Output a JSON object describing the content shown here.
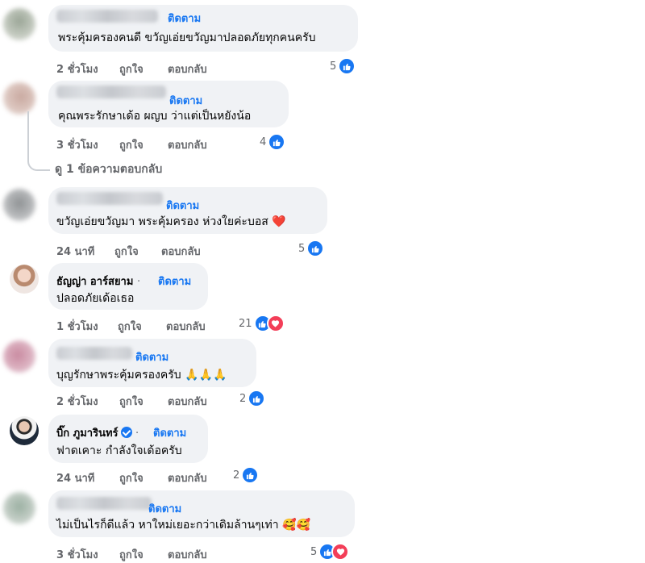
{
  "follow_label": "ติดตาม",
  "action_like": "ถูกใจ",
  "action_reply": "ตอบกลับ",
  "dot_separator": "·",
  "view_replies": "ดู 1 ข้อความตอบกลับ",
  "comments": [
    {
      "name": "",
      "text": "พระคุ้มครองคนดี ขวัญเอ่ยขวัญมาปลอดภัยทุกคนครับ",
      "time": "2 ชั่วโมง",
      "reaction_count": "5",
      "reactions": [
        "like"
      ],
      "emoji": ""
    },
    {
      "name": "",
      "text": "คุณพระรักษาเด้อ ผญบ ว่าแต่เป็นหยังน้อ",
      "time": "3 ชั่วโมง",
      "reaction_count": "4",
      "reactions": [
        "like"
      ],
      "emoji": ""
    },
    {
      "name": "",
      "text": "ขวัญเอ่ยขวัญมา พระคุ้มครอง ห่วงใยค่ะบอส",
      "time": "24 นาที",
      "reaction_count": "5",
      "reactions": [
        "like"
      ],
      "emoji": "❤️"
    },
    {
      "name": "ธัญญ่า อาร์สยาม",
      "text": "ปลอดภัยเด้อเธอ",
      "time": "1 ชั่วโมง",
      "reaction_count": "21",
      "reactions": [
        "like",
        "love"
      ],
      "emoji": ""
    },
    {
      "name": "",
      "text": "บุญรักษาพระคุ้มครองครับ",
      "time": "2 ชั่วโมง",
      "reaction_count": "2",
      "reactions": [
        "like"
      ],
      "emoji": "🙏🙏🙏"
    },
    {
      "name": "บิ๊ก ภูมารินทร์",
      "verified": true,
      "text": "ฟาดเคาะ กำลังใจเด้อครับ",
      "time": "24 นาที",
      "reaction_count": "2",
      "reactions": [
        "like"
      ],
      "emoji": ""
    },
    {
      "name": "",
      "text": "ไม่เป็นไรก็ดีแล้ว หาใหม่เยอะกว่าเดิมล้านๆเท่า",
      "time": "3 ชั่วโมง",
      "reaction_count": "5",
      "reactions": [
        "like",
        "love"
      ],
      "emoji": "🥰🥰"
    }
  ]
}
